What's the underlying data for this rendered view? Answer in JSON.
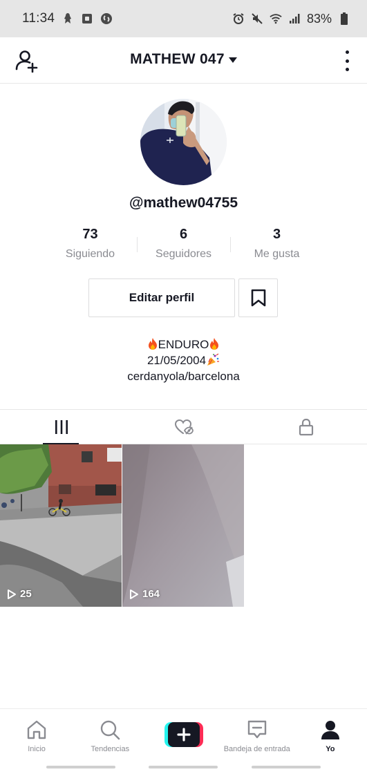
{
  "status_bar": {
    "time": "11:34",
    "battery_percent": "83%"
  },
  "header": {
    "title": "MATHEW 047"
  },
  "profile": {
    "username": "@mathew04755",
    "stats": [
      {
        "value": "73",
        "label": "Siguiendo"
      },
      {
        "value": "6",
        "label": "Seguidores"
      },
      {
        "value": "3",
        "label": "Me gusta"
      }
    ],
    "edit_button_label": "Editar perfil",
    "bio": {
      "line1": "ENDURO",
      "line2": "21/05/2004",
      "line3": "cerdanyola/barcelona"
    }
  },
  "tabs": [
    {
      "icon": "grid-bars-icon",
      "active": true
    },
    {
      "icon": "hidden-heart-icon",
      "active": false
    },
    {
      "icon": "lock-icon",
      "active": false
    }
  ],
  "videos": [
    {
      "views": "25"
    },
    {
      "views": "164"
    }
  ],
  "bottom_nav": {
    "home": "Inicio",
    "discover": "Tendencias",
    "inbox": "Bandeja de entrada",
    "me": "Yo"
  },
  "colors": {
    "accent_cyan": "#25f4ee",
    "accent_pink": "#fe2c55",
    "text_primary": "#161823",
    "text_secondary": "#8a8b91"
  }
}
